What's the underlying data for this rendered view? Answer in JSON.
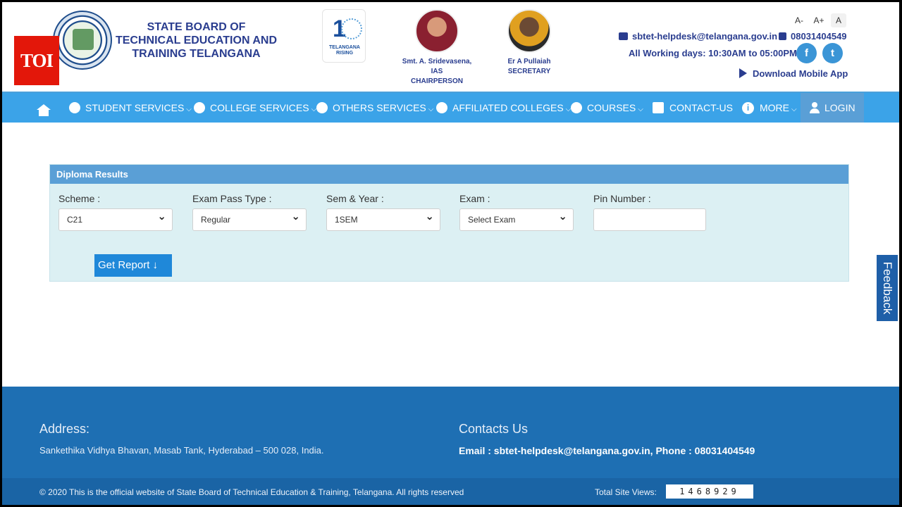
{
  "badge": "TOI",
  "header": {
    "org_title": "STATE BOARD OF TECHNICAL EDUCATION AND TRAINING TELANGANA",
    "rising_logo_text": "TELANGANA RISING",
    "people": [
      {
        "name": "Smt. A. Sridevasena,",
        "title": "IAS",
        "role": "CHAIRPERSON"
      },
      {
        "name": "Er A Pullaiah",
        "role": "SECRETARY"
      }
    ],
    "font_controls": [
      "A-",
      "A+",
      "A"
    ],
    "email": "sbtet-helpdesk@telangana.gov.in",
    "phone": "08031404549",
    "hours": "All Working days: 10:30AM to 05:00PM",
    "download_app": "Download Mobile App",
    "social": {
      "facebook": "f",
      "twitter": "t"
    }
  },
  "nav": {
    "home_icon": "home-icon",
    "items": [
      {
        "label": "STUDENT SERVICES",
        "icon": "gear-icon",
        "dropdown": true
      },
      {
        "label": "COLLEGE SERVICES",
        "icon": "gear-icon",
        "dropdown": true
      },
      {
        "label": "OTHERS SERVICES",
        "icon": "gear-icon",
        "dropdown": true
      },
      {
        "label": "AFFILIATED COLLEGES",
        "icon": "gear-icon",
        "dropdown": true
      },
      {
        "label": "COURSES",
        "icon": "gear-icon",
        "dropdown": true
      },
      {
        "label": "CONTACT-US",
        "icon": "contact-icon",
        "dropdown": false
      },
      {
        "label": "MORE",
        "icon": "info-icon",
        "dropdown": true
      },
      {
        "label": "LOGIN",
        "icon": "user-icon",
        "dropdown": false
      }
    ]
  },
  "results": {
    "title": "Diploma Results",
    "fields": {
      "scheme": {
        "label": "Scheme :",
        "value": "C21"
      },
      "pass_type": {
        "label": "Exam Pass Type :",
        "value": "Regular"
      },
      "sem_year": {
        "label": "Sem & Year :",
        "value": "1SEM"
      },
      "exam": {
        "label": "Exam :",
        "value": "Select Exam"
      },
      "pin": {
        "label": "Pin Number :",
        "value": ""
      }
    },
    "button": "Get Report ↓"
  },
  "feedback": "Feedback",
  "footer": {
    "address_heading": "Address:",
    "address_text": "Sankethika Vidhya Bhavan, Masab Tank, Hyderabad – 500 028, India.",
    "contacts_heading": "Contacts Us",
    "contacts_text": "Email : sbtet-helpdesk@telangana.gov.in, Phone : 08031404549",
    "copyright": "© 2020 This is the official website of State Board of Technical Education & Training, Telangana. All rights reserved",
    "views_label": "Total Site Views:",
    "views_value": "1468929"
  },
  "colors": {
    "nav": "#3ba3e8",
    "panel_header": "#5a9fd6",
    "footer": "#1e6fb3",
    "button": "#1f88d9",
    "title": "#2a3d8f"
  }
}
